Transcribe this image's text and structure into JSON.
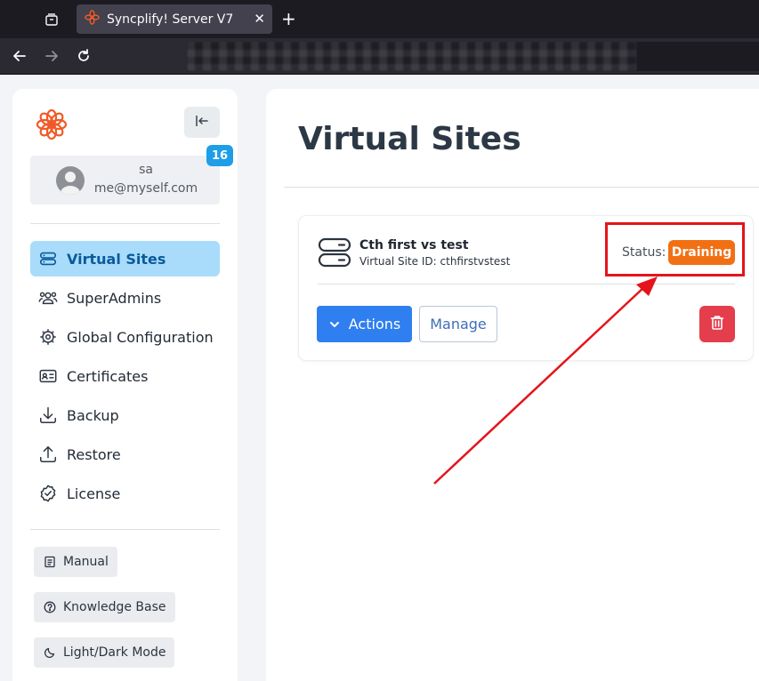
{
  "browser": {
    "tab_title": "Syncplify! Server V7",
    "tab_close": "✕",
    "new_tab": "+"
  },
  "sidebar": {
    "user": {
      "name": "sa",
      "email": "me@myself.com",
      "notification_count": "16"
    },
    "nav_items": [
      {
        "label": "Virtual Sites",
        "icon": "server-stack-icon",
        "active": true
      },
      {
        "label": "SuperAdmins",
        "icon": "users-icon"
      },
      {
        "label": "Global Configuration",
        "icon": "cog-icon"
      },
      {
        "label": "Certificates",
        "icon": "id-card-icon"
      },
      {
        "label": "Backup",
        "icon": "download-icon"
      },
      {
        "label": "Restore",
        "icon": "upload-icon"
      },
      {
        "label": "License",
        "icon": "check-badge-icon"
      }
    ],
    "utility_buttons": [
      {
        "label": "Manual",
        "icon": "book-icon"
      },
      {
        "label": "Knowledge Base",
        "icon": "question-circle-icon"
      },
      {
        "label": "Light/Dark Mode",
        "icon": "moon-icon"
      }
    ]
  },
  "main": {
    "title": "Virtual Sites",
    "site": {
      "name": "Cth first vs test",
      "id_line": "Virtual Site ID: cthfirstvstest",
      "status_label": "Status:",
      "status_value": "Draining",
      "actions_label": "Actions",
      "manage_label": "Manage"
    }
  },
  "colors": {
    "accent": "#2f7ff0",
    "status_draining": "#f27014",
    "danger": "#e43d4b",
    "active_nav": "#a9dcfb",
    "annotation": "#e5141b",
    "brand": "#f05a28"
  }
}
